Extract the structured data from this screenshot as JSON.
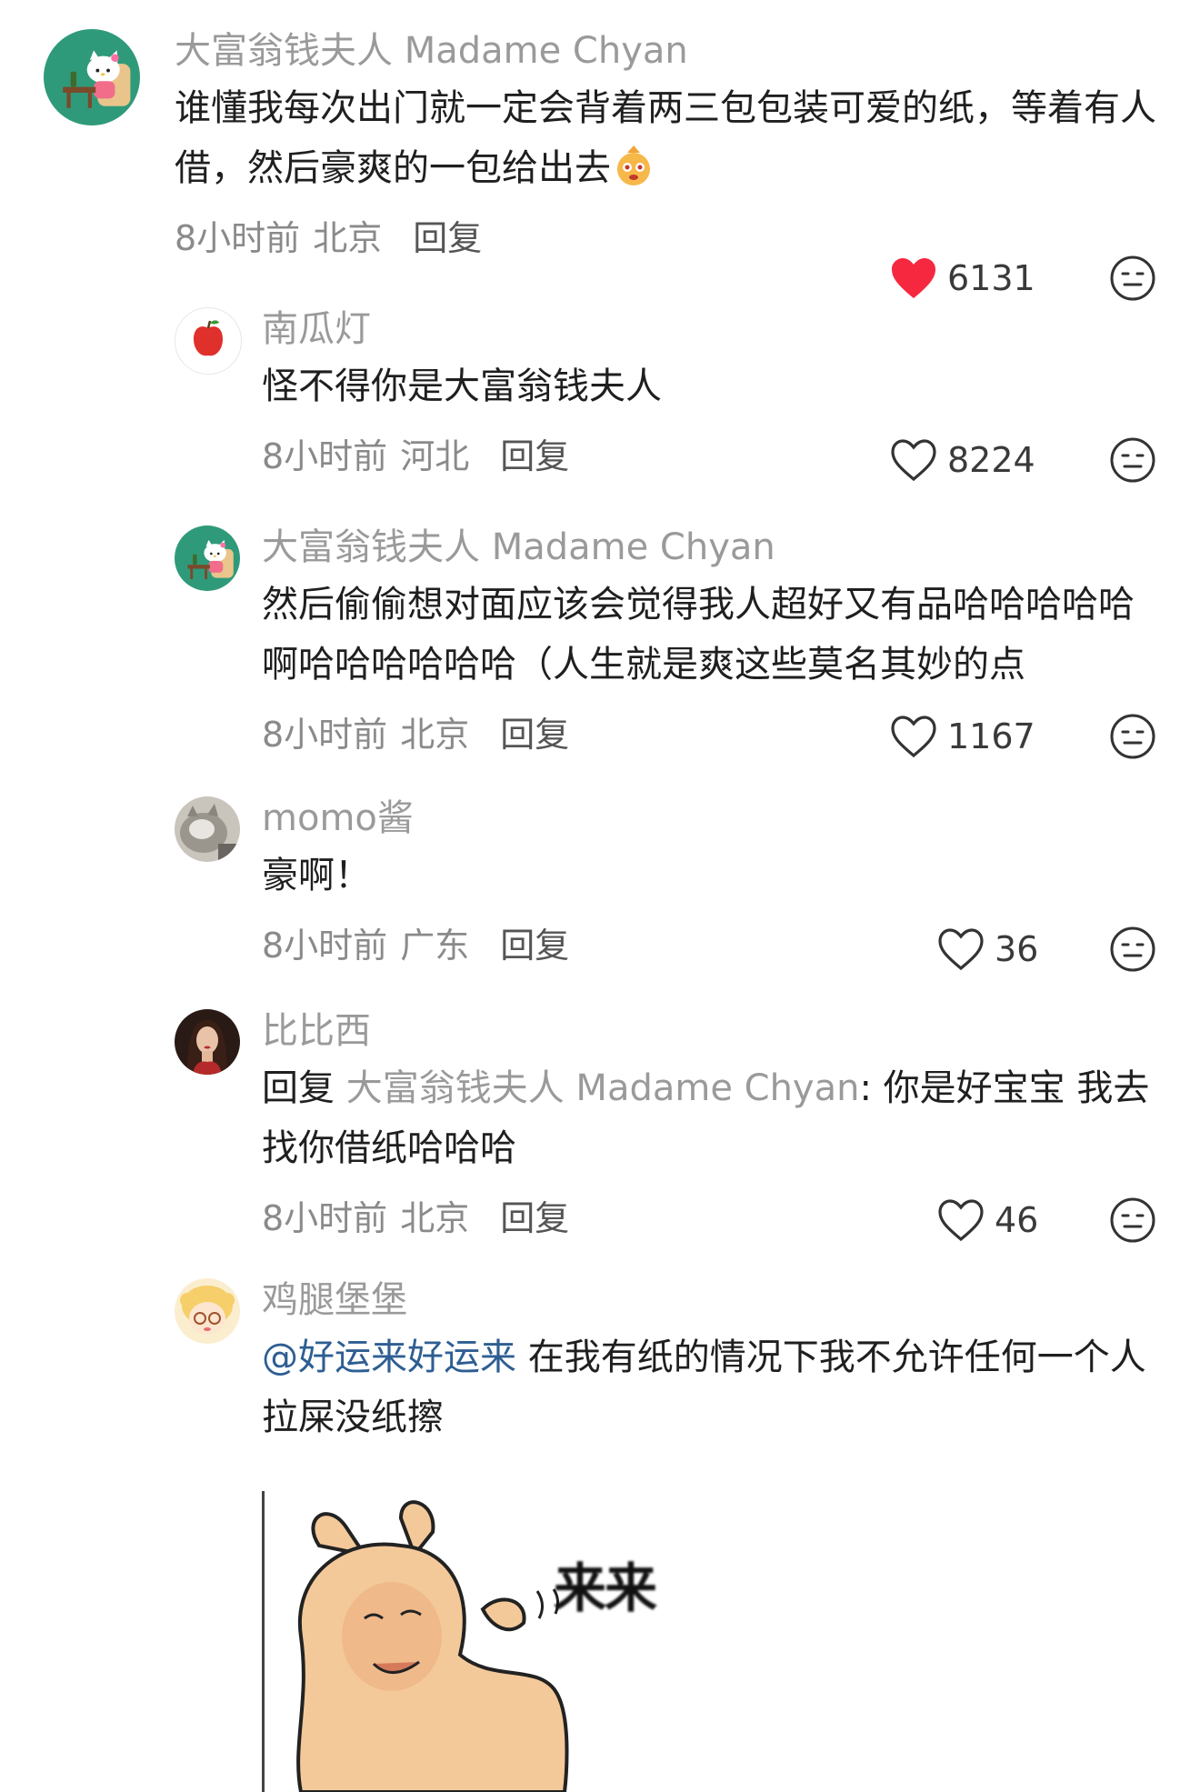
{
  "comments": [
    {
      "name": "大富翁钱夫人 Madame Chyan",
      "text": "谁懂我每次出门就一定会背着两三包包装可爱的纸，等着有人借，然后豪爽的一包给出去",
      "time": "8小时前",
      "location": "北京",
      "reply_label": "回复",
      "likes": "6131",
      "liked": true,
      "avatar": "hello-kitty-avatar"
    },
    {
      "name": "南瓜灯",
      "text": "怪不得你是大富翁钱夫人",
      "time": "8小时前",
      "location": "河北",
      "reply_label": "回复",
      "likes": "8224",
      "liked": false,
      "avatar": "apple-avatar"
    },
    {
      "name": "大富翁钱夫人 Madame Chyan",
      "text": "然后偷偷想对面应该会觉得我人超好又有品哈哈哈哈哈啊哈哈哈哈哈哈（人生就是爽这些莫名其妙的点",
      "time": "8小时前",
      "location": "北京",
      "reply_label": "回复",
      "likes": "1167",
      "liked": false,
      "avatar": "hello-kitty-avatar"
    },
    {
      "name": "momo酱",
      "text": "豪啊！",
      "time": "8小时前",
      "location": "广东",
      "reply_label": "回复",
      "likes": "36",
      "liked": false,
      "avatar": "cat-avatar"
    },
    {
      "name": "比比西",
      "reply_prefix": "回复 ",
      "reply_to": "大富翁钱夫人 Madame Chyan",
      "text": ": 你是好宝宝 我去找你借纸哈哈哈",
      "time": "8小时前",
      "location": "北京",
      "reply_label": "回复",
      "likes": "46",
      "liked": false,
      "avatar": "woman-avatar"
    },
    {
      "name": "鸡腿堡堡",
      "mention": "@好运来好运来",
      "text": " 在我有纸的情况下我不允许任何一个人拉屎没纸擦",
      "avatar": "cartoon-girl-avatar",
      "sticker_text": "来来"
    }
  ],
  "colors": {
    "like_red": "#f5283f",
    "mention_blue": "#2e5e92",
    "gray_text": "#9a9a9a"
  }
}
